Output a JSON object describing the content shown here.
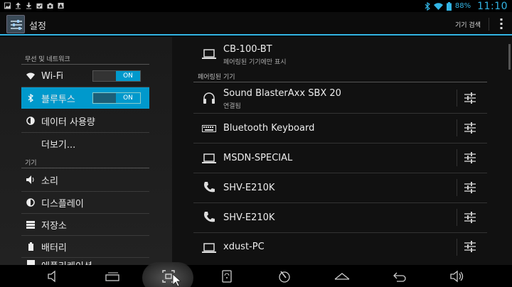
{
  "status_bar": {
    "left_icons": [
      "image-icon",
      "upload-icon",
      "download-icon",
      "clipboard-check-icon",
      "camera-icon",
      "alert-icon"
    ],
    "battery": "88%",
    "time": "11:10",
    "accent_color": "#33b5e5"
  },
  "action_bar": {
    "title": "설정",
    "search_label": "기기 검색"
  },
  "sidebar": {
    "section_wireless": "무선 및 네트워크",
    "section_device": "기기",
    "items": [
      {
        "label": "Wi-Fi",
        "icon": "wifi-icon",
        "toggle": "ON"
      },
      {
        "label": "블루투스",
        "icon": "bluetooth-icon",
        "toggle": "ON",
        "active": true
      },
      {
        "label": "데이터 사용량",
        "icon": "data-usage-icon"
      },
      {
        "label": "더보기...",
        "icon": ""
      },
      {
        "label": "소리",
        "icon": "sound-icon"
      },
      {
        "label": "디스플레이",
        "icon": "display-icon"
      },
      {
        "label": "저장소",
        "icon": "storage-icon"
      },
      {
        "label": "배터리",
        "icon": "battery-icon"
      },
      {
        "label": "애플리케이션",
        "icon": "apps-icon"
      }
    ]
  },
  "bluetooth": {
    "this_device": {
      "name": "CB-100-BT",
      "sub": "페어링된 기기에만 표시",
      "icon": "laptop-icon"
    },
    "paired_header": "페어링된 기기",
    "paired": [
      {
        "name": "Sound BlasterAxx SBX 20",
        "sub": "연결됨",
        "icon": "headset-icon"
      },
      {
        "name": "Bluetooth Keyboard",
        "sub": "",
        "icon": "keyboard-icon"
      },
      {
        "name": "MSDN-SPECIAL",
        "sub": "",
        "icon": "laptop-icon"
      },
      {
        "name": "SHV-E210K",
        "sub": "",
        "icon": "phone-icon"
      },
      {
        "name": "SHV-E210K",
        "sub": "",
        "icon": "phone-icon"
      },
      {
        "name": "xdust-PC",
        "sub": "",
        "icon": "laptop-icon"
      }
    ]
  },
  "nav_bar": {
    "buttons": [
      "volume-down-icon",
      "recent-apps-icon",
      "screenshot-icon",
      "memo-icon",
      "pen-icon",
      "home-icon",
      "back-icon",
      "volume-up-icon"
    ]
  }
}
